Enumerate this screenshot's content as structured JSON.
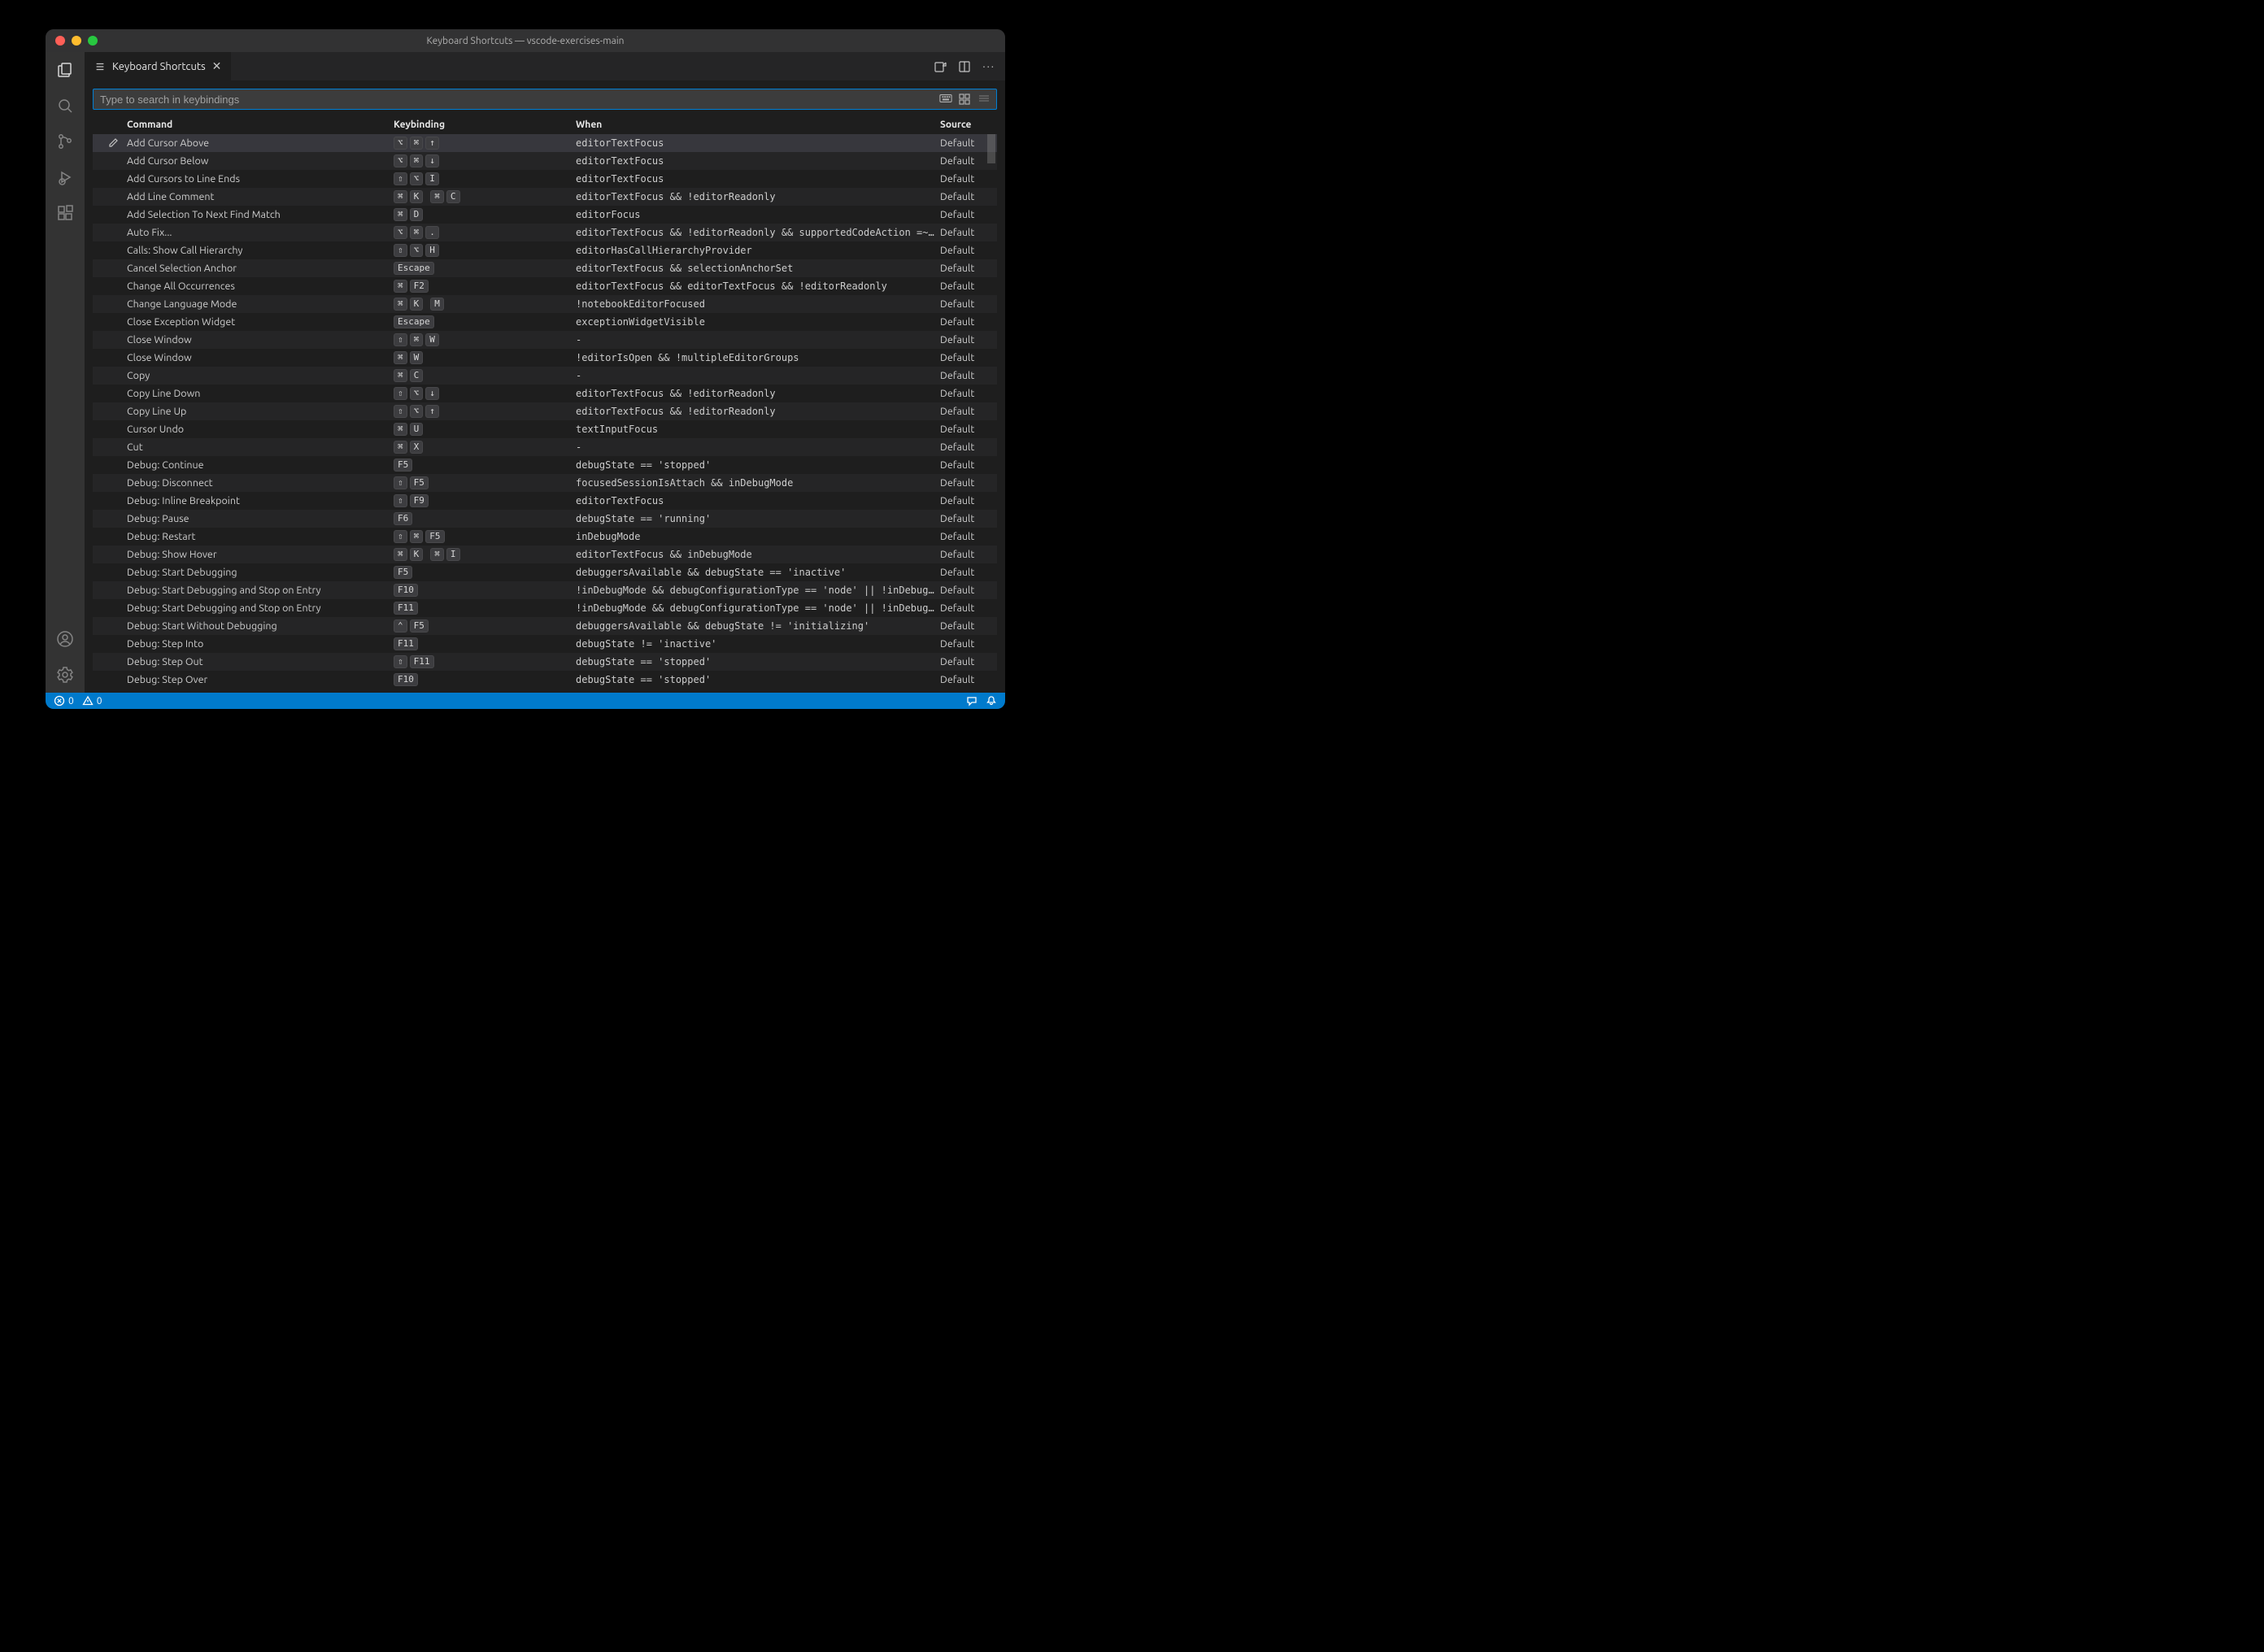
{
  "window_title": "Keyboard Shortcuts — vscode-exercises-main",
  "tab": {
    "label": "Keyboard Shortcuts"
  },
  "search": {
    "placeholder": "Type to search in keybindings"
  },
  "headers": {
    "command": "Command",
    "keybinding": "Keybinding",
    "when": "When",
    "source": "Source"
  },
  "status": {
    "errors": "0",
    "warnings": "0"
  },
  "source_label": "Default",
  "rows": [
    {
      "selected": true,
      "command": "Add Cursor Above",
      "keys": [
        [
          "⌥",
          "⌘",
          "↑"
        ]
      ],
      "when": "editorTextFocus",
      "source": "Default"
    },
    {
      "command": "Add Cursor Below",
      "keys": [
        [
          "⌥",
          "⌘",
          "↓"
        ]
      ],
      "when": "editorTextFocus",
      "source": "Default"
    },
    {
      "command": "Add Cursors to Line Ends",
      "keys": [
        [
          "⇧",
          "⌥",
          "I"
        ]
      ],
      "when": "editorTextFocus",
      "source": "Default"
    },
    {
      "command": "Add Line Comment",
      "keys": [
        [
          "⌘",
          "K"
        ],
        [
          "⌘",
          "C"
        ]
      ],
      "when": "editorTextFocus && !editorReadonly",
      "source": "Default"
    },
    {
      "command": "Add Selection To Next Find Match",
      "keys": [
        [
          "⌘",
          "D"
        ]
      ],
      "when": "editorFocus",
      "source": "Default"
    },
    {
      "command": "Auto Fix...",
      "keys": [
        [
          "⌥",
          "⌘",
          "."
        ]
      ],
      "when": "editorTextFocus && !editorReadonly && supportedCodeAction =~…",
      "source": "Default"
    },
    {
      "command": "Calls: Show Call Hierarchy",
      "keys": [
        [
          "⇧",
          "⌥",
          "H"
        ]
      ],
      "when": "editorHasCallHierarchyProvider",
      "source": "Default"
    },
    {
      "command": "Cancel Selection Anchor",
      "keys": [
        [
          "Escape"
        ]
      ],
      "when": "editorTextFocus && selectionAnchorSet",
      "source": "Default"
    },
    {
      "command": "Change All Occurrences",
      "keys": [
        [
          "⌘",
          "F2"
        ]
      ],
      "when": "editorTextFocus && editorTextFocus && !editorReadonly",
      "source": "Default"
    },
    {
      "command": "Change Language Mode",
      "keys": [
        [
          "⌘",
          "K"
        ],
        [
          "M"
        ]
      ],
      "when": "!notebookEditorFocused",
      "source": "Default"
    },
    {
      "command": "Close Exception Widget",
      "keys": [
        [
          "Escape"
        ]
      ],
      "when": "exceptionWidgetVisible",
      "source": "Default"
    },
    {
      "command": "Close Window",
      "keys": [
        [
          "⇧",
          "⌘",
          "W"
        ]
      ],
      "when": "-",
      "source": "Default"
    },
    {
      "command": "Close Window",
      "keys": [
        [
          "⌘",
          "W"
        ]
      ],
      "when": "!editorIsOpen && !multipleEditorGroups",
      "source": "Default"
    },
    {
      "command": "Copy",
      "keys": [
        [
          "⌘",
          "C"
        ]
      ],
      "when": "-",
      "source": "Default"
    },
    {
      "command": "Copy Line Down",
      "keys": [
        [
          "⇧",
          "⌥",
          "↓"
        ]
      ],
      "when": "editorTextFocus && !editorReadonly",
      "source": "Default"
    },
    {
      "command": "Copy Line Up",
      "keys": [
        [
          "⇧",
          "⌥",
          "↑"
        ]
      ],
      "when": "editorTextFocus && !editorReadonly",
      "source": "Default"
    },
    {
      "command": "Cursor Undo",
      "keys": [
        [
          "⌘",
          "U"
        ]
      ],
      "when": "textInputFocus",
      "source": "Default"
    },
    {
      "command": "Cut",
      "keys": [
        [
          "⌘",
          "X"
        ]
      ],
      "when": "-",
      "source": "Default"
    },
    {
      "command": "Debug: Continue",
      "keys": [
        [
          "F5"
        ]
      ],
      "when": "debugState == 'stopped'",
      "source": "Default"
    },
    {
      "command": "Debug: Disconnect",
      "keys": [
        [
          "⇧",
          "F5"
        ]
      ],
      "when": "focusedSessionIsAttach && inDebugMode",
      "source": "Default"
    },
    {
      "command": "Debug: Inline Breakpoint",
      "keys": [
        [
          "⇧",
          "F9"
        ]
      ],
      "when": "editorTextFocus",
      "source": "Default"
    },
    {
      "command": "Debug: Pause",
      "keys": [
        [
          "F6"
        ]
      ],
      "when": "debugState == 'running'",
      "source": "Default"
    },
    {
      "command": "Debug: Restart",
      "keys": [
        [
          "⇧",
          "⌘",
          "F5"
        ]
      ],
      "when": "inDebugMode",
      "source": "Default"
    },
    {
      "command": "Debug: Show Hover",
      "keys": [
        [
          "⌘",
          "K"
        ],
        [
          "⌘",
          "I"
        ]
      ],
      "when": "editorTextFocus && inDebugMode",
      "source": "Default"
    },
    {
      "command": "Debug: Start Debugging",
      "keys": [
        [
          "F5"
        ]
      ],
      "when": "debuggersAvailable && debugState == 'inactive'",
      "source": "Default"
    },
    {
      "command": "Debug: Start Debugging and Stop on Entry",
      "keys": [
        [
          "F10"
        ]
      ],
      "when": "!inDebugMode && debugConfigurationType == 'node' || !inDebug…",
      "source": "Default"
    },
    {
      "command": "Debug: Start Debugging and Stop on Entry",
      "keys": [
        [
          "F11"
        ]
      ],
      "when": "!inDebugMode && debugConfigurationType == 'node' || !inDebug…",
      "source": "Default"
    },
    {
      "command": "Debug: Start Without Debugging",
      "keys": [
        [
          "⌃",
          "F5"
        ]
      ],
      "when": "debuggersAvailable && debugState != 'initializing'",
      "source": "Default"
    },
    {
      "command": "Debug: Step Into",
      "keys": [
        [
          "F11"
        ]
      ],
      "when": "debugState != 'inactive'",
      "source": "Default"
    },
    {
      "command": "Debug: Step Out",
      "keys": [
        [
          "⇧",
          "F11"
        ]
      ],
      "when": "debugState == 'stopped'",
      "source": "Default"
    },
    {
      "command": "Debug: Step Over",
      "keys": [
        [
          "F10"
        ]
      ],
      "when": "debugState == 'stopped'",
      "source": "Default"
    }
  ]
}
